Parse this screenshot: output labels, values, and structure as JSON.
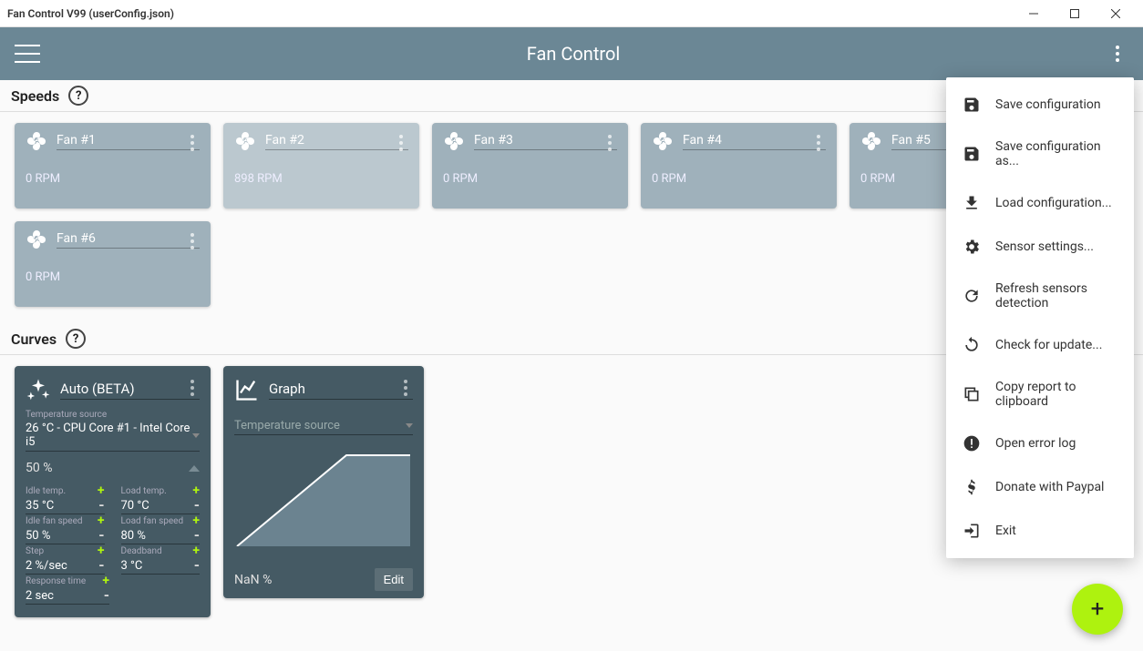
{
  "window": {
    "title": "Fan Control V99 (userConfig.json)"
  },
  "appbar": {
    "title": "Fan Control"
  },
  "sections": {
    "speeds": "Speeds",
    "curves": "Curves"
  },
  "speeds": [
    {
      "name": "Fan #1",
      "rpm": "0 RPM",
      "muted": false
    },
    {
      "name": "Fan #2",
      "rpm": "898 RPM",
      "muted": true
    },
    {
      "name": "Fan #3",
      "rpm": "0 RPM",
      "muted": false
    },
    {
      "name": "Fan #4",
      "rpm": "0 RPM",
      "muted": false
    },
    {
      "name": "Fan #5",
      "rpm": "0 RPM",
      "muted": false
    },
    {
      "name": "Fan #6",
      "rpm": "0 RPM",
      "muted": false
    }
  ],
  "autoCurve": {
    "name": "Auto (BETA)",
    "tempSourceLabel": "Temperature source",
    "tempSource": "26 °C - CPU Core #1 - Intel Core i5",
    "percent": "50 %",
    "params": {
      "idleTemp": {
        "label": "Idle temp.",
        "value": "35 °C"
      },
      "loadTemp": {
        "label": "Load temp.",
        "value": "70 °C"
      },
      "idleFan": {
        "label": "Idle fan speed",
        "value": "50 %"
      },
      "loadFan": {
        "label": "Load fan speed",
        "value": "80 %"
      },
      "step": {
        "label": "Step",
        "value": "2 %/sec"
      },
      "deadband": {
        "label": "Deadband",
        "value": "3 °C"
      },
      "response": {
        "label": "Response time",
        "value": "2 sec"
      }
    }
  },
  "graphCurve": {
    "name": "Graph",
    "tempSourceLabel": "Temperature source",
    "percent": "NaN %",
    "editLabel": "Edit"
  },
  "menu": {
    "save": "Save configuration",
    "saveAs": "Save configuration as...",
    "load": "Load configuration...",
    "sensor": "Sensor settings...",
    "refresh": "Refresh sensors detection",
    "update": "Check for update...",
    "copy": "Copy report to clipboard",
    "errorlog": "Open error log",
    "donate": "Donate with Paypal",
    "exit": "Exit"
  }
}
